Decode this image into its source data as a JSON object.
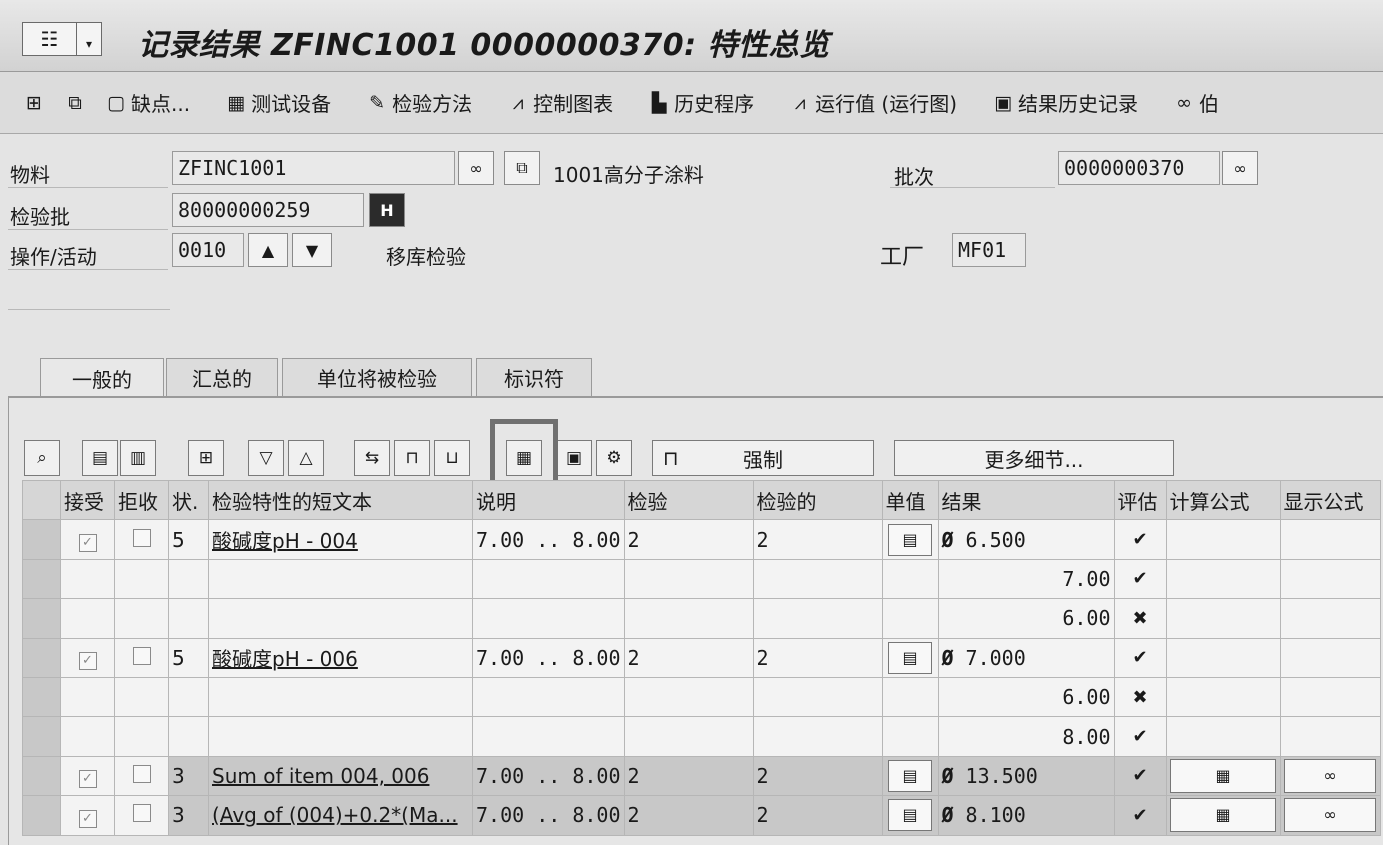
{
  "title_bar": {
    "sys_icon": "menu-icon",
    "title": "记录结果 ZFINC1001 0000000370: 特性总览"
  },
  "toolbar": {
    "icon_buttons": [
      "hierarchy-icon",
      "copy-icon"
    ],
    "items": [
      {
        "icon": "document-icon",
        "label": "缺点..."
      },
      {
        "icon": "grid-icon",
        "label": "测试设备"
      },
      {
        "icon": "edit-icon",
        "label": "检验方法"
      },
      {
        "icon": "chart-icon",
        "label": "控制图表"
      },
      {
        "icon": "bar-chart-icon",
        "label": "历史程序"
      },
      {
        "icon": "run-chart-icon",
        "label": "运行值 (运行图)"
      },
      {
        "icon": "monitor-icon",
        "label": "结果历史记录"
      },
      {
        "icon": "glasses-icon",
        "label": "伯"
      }
    ]
  },
  "header": {
    "material_label": "物料",
    "material_value": "ZFINC1001",
    "material_desc": "1001高分子涂料",
    "lot_label": "批次",
    "lot_value": "0000000370",
    "insp_lot_label": "检验批",
    "insp_lot_value": "80000000259",
    "operation_label": "操作/活动",
    "operation_value": "0010",
    "operation_desc": "移库检验",
    "plant_label": "工厂",
    "plant_value": "MF01"
  },
  "tabs": [
    "一般的",
    "汇总的",
    "单位将被检验",
    "标识符"
  ],
  "grid_toolbar": {
    "force_label": "强制",
    "more_details_label": "更多细节..."
  },
  "grid": {
    "columns": [
      "接受",
      "拒收",
      "状.",
      "检验特性的短文本",
      "说明",
      "检验",
      "检验的",
      "单值",
      "结果",
      "评估",
      "计算公式",
      "显示公式"
    ],
    "rows": [
      {
        "accept": true,
        "reject": false,
        "status": "5",
        "text": "酸碱度pH - 004",
        "spec": "7.00 .. 8.00",
        "insp": "2",
        "inspected": "2",
        "single_btn": true,
        "avg": "Ø",
        "result": "6.500",
        "eval": "✔",
        "formula": false
      },
      {
        "accept": null,
        "reject": null,
        "status": "",
        "text": "",
        "spec": "",
        "insp": "",
        "inspected": "",
        "single_btn": false,
        "avg": "",
        "result": "7.00",
        "eval": "✔",
        "formula": false
      },
      {
        "accept": null,
        "reject": null,
        "status": "",
        "text": "",
        "spec": "",
        "insp": "",
        "inspected": "",
        "single_btn": false,
        "avg": "",
        "result": "6.00",
        "eval": "✖",
        "formula": false
      },
      {
        "accept": true,
        "reject": false,
        "status": "5",
        "text": "酸碱度pH - 006",
        "spec": "7.00 .. 8.00",
        "insp": "2",
        "inspected": "2",
        "single_btn": true,
        "avg": "Ø",
        "result": "7.000",
        "eval": "✔",
        "formula": false
      },
      {
        "accept": null,
        "reject": null,
        "status": "",
        "text": "",
        "spec": "",
        "insp": "",
        "inspected": "",
        "single_btn": false,
        "avg": "",
        "result": "6.00",
        "eval": "✖",
        "formula": false
      },
      {
        "accept": null,
        "reject": null,
        "status": "",
        "text": "",
        "spec": "",
        "insp": "",
        "inspected": "",
        "single_btn": false,
        "avg": "",
        "result": "8.00",
        "eval": "✔",
        "formula": false
      },
      {
        "accept": true,
        "reject": false,
        "status": "3",
        "text": "Sum of item  004, 006",
        "spec": "7.00 .. 8.00",
        "insp": "2",
        "inspected": "2",
        "single_btn": true,
        "avg": "Ø",
        "result": "13.500",
        "eval": "✔",
        "formula": true
      },
      {
        "accept": true,
        "reject": false,
        "status": "3",
        "text": "(Avg of (004)+0.2*(Ma...",
        "spec": "7.00 .. 8.00",
        "insp": "2",
        "inspected": "2",
        "single_btn": true,
        "avg": "Ø",
        "result": "8.100",
        "eval": "✔",
        "formula": true
      }
    ]
  }
}
